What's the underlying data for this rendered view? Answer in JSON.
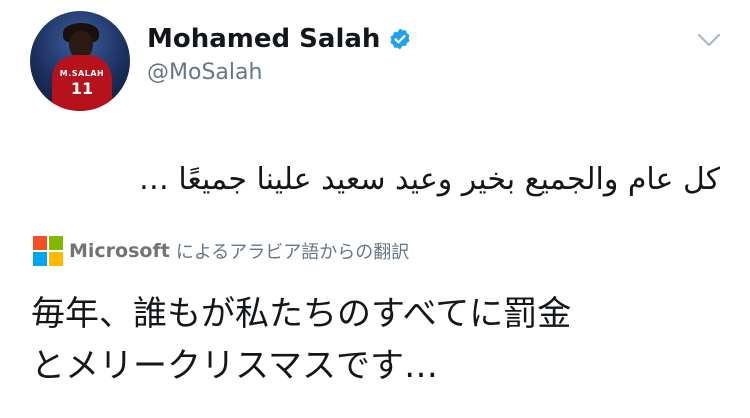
{
  "user": {
    "display_name": "Mohamed Salah",
    "handle": "@MoSalah",
    "avatar_shirt_name": "M.SALAH",
    "avatar_shirt_number": "11"
  },
  "tweet": {
    "text": "كل عام والجميع بخير وعيد سعيد علينا جميعًا …"
  },
  "translation": {
    "brand": "Microsoft",
    "caption": "によるアラビア語からの翻訳",
    "text_line1": "毎年、誰もが私たちのすべてに罰金",
    "text_line2": "とメリークリスマスです…"
  },
  "icons": {
    "verified": "verified-badge-icon",
    "menu": "chevron-down-icon",
    "microsoft_logo": "microsoft-logo-icon"
  },
  "colors": {
    "verified_blue": "#1da1f2",
    "ms_red": "#f25022",
    "ms_green": "#7fba00",
    "ms_blue": "#00a4ef",
    "ms_yellow": "#ffb900"
  }
}
